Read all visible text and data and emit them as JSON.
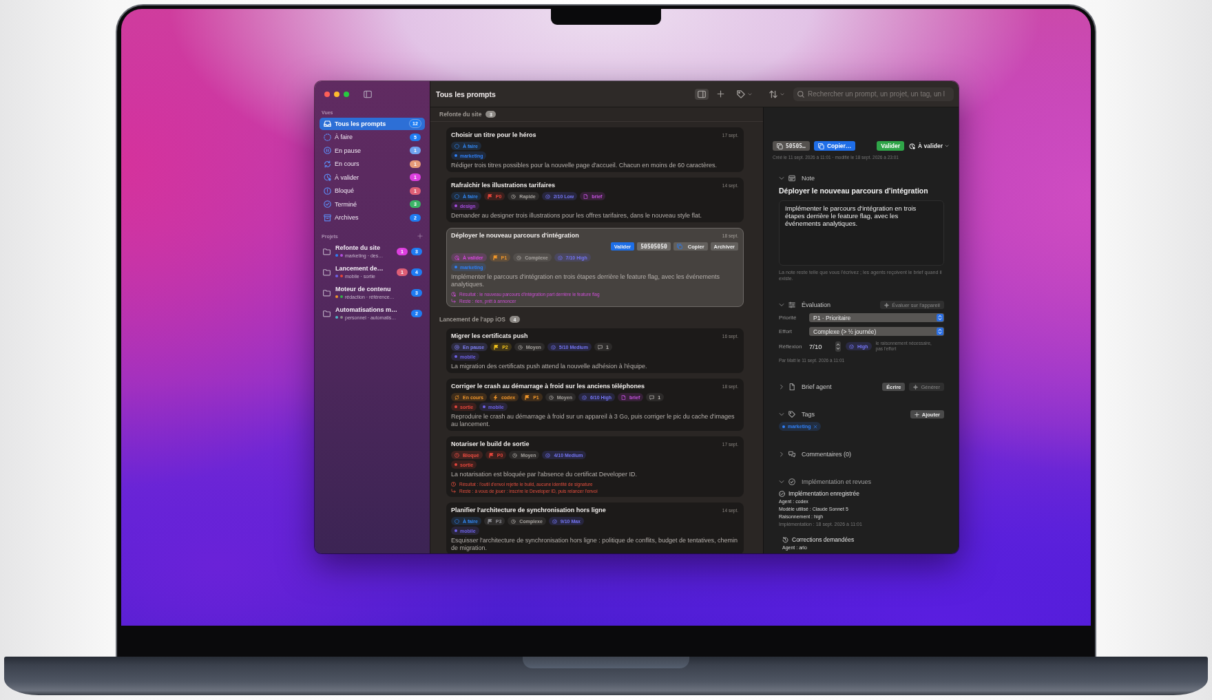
{
  "window": {
    "title": "Tous les prompts"
  },
  "toolbar": {
    "inspector_on": true,
    "search": {
      "placeholder": "Rechercher un prompt, un projet, un tag, un l"
    }
  },
  "sidebar": {
    "views_label": "Vues",
    "views": [
      {
        "kind": "all",
        "label": "Tous les prompts",
        "count": "12",
        "color": "#1f7cf2",
        "selected": true
      },
      {
        "kind": "todo",
        "label": "À faire",
        "count": "5",
        "color": "#1f7cf2",
        "selected": false
      },
      {
        "kind": "paused",
        "label": "En pause",
        "count": "1",
        "color": "#6fa3ef",
        "selected": false
      },
      {
        "kind": "in_progress",
        "label": "En cours",
        "count": "1",
        "color": "#e59a78",
        "selected": false
      },
      {
        "kind": "review",
        "label": "À valider",
        "count": "1",
        "color": "#dd3fdf",
        "selected": false
      },
      {
        "kind": "blocked",
        "label": "Bloqué",
        "count": "1",
        "color": "#de5f76",
        "selected": false
      },
      {
        "kind": "done",
        "label": "Terminé",
        "count": "3",
        "color": "#3bb466",
        "selected": false
      },
      {
        "kind": "archive",
        "label": "Archives",
        "count": "2",
        "color": "#1f7cf2",
        "selected": false
      }
    ],
    "projects_label": "Projets",
    "projects": [
      {
        "name": "Refonte du site",
        "summary": "marketing · des…",
        "tag_dots": [
          {
            "color": "#2f7ff5"
          },
          {
            "color": "#b34fe0"
          }
        ],
        "badges": [
          {
            "count": "1",
            "color": "#dd3fdf"
          },
          {
            "count": "3",
            "color": "#1f7cf2"
          }
        ],
        "selected": false
      },
      {
        "name": "Lancement de…",
        "summary": "mobile · sortie",
        "tag_dots": [
          {
            "color": "#6d62e8"
          },
          {
            "color": "#e5453b"
          }
        ],
        "badges": [
          {
            "count": "1",
            "color": "#de5f76"
          },
          {
            "count": "4",
            "color": "#1f7cf2"
          }
        ],
        "selected": false
      },
      {
        "name": "Moteur de contenu",
        "summary": "rédaction · référence…",
        "tag_dots": [
          {
            "color": "#f0962a"
          },
          {
            "color": "#35b24a"
          }
        ],
        "badges": [
          {
            "count": "3",
            "color": "#1f7cf2"
          }
        ],
        "selected": false
      },
      {
        "name": "Automatisations m…",
        "summary": "personnel · automatis…",
        "tag_dots": [
          {
            "color": "#4fb8c8"
          },
          {
            "color": "#8a8a8a"
          }
        ],
        "badges": [
          {
            "count": "2",
            "color": "#1f7cf2"
          }
        ],
        "selected": false
      }
    ]
  },
  "list": {
    "groups": [
      {
        "title": "Refonte du site",
        "count": "3",
        "cards": [
          {
            "title": "Choisir un titre pour le héros",
            "date": "17 sept.",
            "selected": false,
            "status": {
              "kind": "todo",
              "label": "À faire"
            },
            "tags": [
              {
                "label": "marketing",
                "color": "#2f7ff5"
              }
            ],
            "description": "Rédiger trois titres possibles pour la nouvelle page d'accueil. Chacun en moins de 60 caractères."
          },
          {
            "title": "Rafraîchir les illustrations tarifaires",
            "date": "14 sept.",
            "selected": false,
            "status": {
              "kind": "todo",
              "label": "À faire"
            },
            "chips": [
              {
                "kind": "priority",
                "label": "P0",
                "color": "#e5453b"
              },
              {
                "kind": "effort",
                "label": "Rapide"
              },
              {
                "kind": "reasoning",
                "label": "2/10 Low"
              },
              {
                "kind": "brief",
                "label": "brief"
              }
            ],
            "tags": [
              {
                "label": "design",
                "color": "#a64de0"
              }
            ],
            "description": "Demander au designer trois illustrations pour les offres tarifaires, dans le nouveau style flat."
          },
          {
            "title": "Déployer le nouveau parcours d'intégration",
            "date": "18 sept.",
            "selected": true,
            "actions": [
              {
                "kind": "validate",
                "label": "Valider"
              },
              {
                "kind": "id",
                "label": "50505050"
              },
              {
                "kind": "copy",
                "label": "Copier"
              },
              {
                "kind": "archive",
                "label": "Archiver"
              }
            ],
            "status": {
              "kind": "review",
              "label": "À valider"
            },
            "chips": [
              {
                "kind": "priority",
                "label": "P1",
                "color": "#f0962a"
              },
              {
                "kind": "effort",
                "label": "Complexe"
              },
              {
                "kind": "reasoning",
                "label": "7/10 High"
              }
            ],
            "tags": [
              {
                "label": "marketing",
                "color": "#2f7ff5"
              }
            ],
            "description": "Implémenter le parcours d'intégration en trois étapes derrière le feature flag, avec les événements analytiques.",
            "outcome": [
              {
                "kind": "result",
                "text": "Résultat : le nouveau parcours d'intégration part derrière le feature flag"
              },
              {
                "kind": "remaining",
                "text": "Reste : rien, prêt à annoncer"
              }
            ]
          }
        ]
      },
      {
        "title": "Lancement de l'app iOS",
        "count": "4",
        "cards": [
          {
            "title": "Migrer les certificats push",
            "date": "16 sept.",
            "selected": false,
            "status": {
              "kind": "paused",
              "label": "En pause"
            },
            "chips": [
              {
                "kind": "priority",
                "label": "P2",
                "color": "#f2c21c"
              },
              {
                "kind": "effort",
                "label": "Moyen"
              },
              {
                "kind": "reasoning",
                "label": "5/10 Medium"
              },
              {
                "kind": "comments",
                "label": "1"
              }
            ],
            "tags": [
              {
                "label": "mobile",
                "color": "#6d62e8"
              }
            ],
            "description": "La migration des certificats push attend la nouvelle adhésion à l'équipe."
          },
          {
            "title": "Corriger le crash au démarrage à froid sur les anciens téléphones",
            "date": "18 sept.",
            "selected": false,
            "status": {
              "kind": "in_progress",
              "label": "En cours"
            },
            "chips": [
              {
                "kind": "agent",
                "label": "codex"
              },
              {
                "kind": "priority",
                "label": "P1",
                "color": "#f0962a"
              },
              {
                "kind": "effort",
                "label": "Moyen"
              },
              {
                "kind": "reasoning",
                "label": "6/10 High"
              },
              {
                "kind": "brief",
                "label": "brief"
              },
              {
                "kind": "comments",
                "label": "1"
              }
            ],
            "tags": [
              {
                "label": "sortie",
                "color": "#e5453b"
              },
              {
                "label": "mobile",
                "color": "#6d62e8"
              }
            ],
            "description": "Reproduire le crash au démarrage à froid sur un appareil à 3 Go, puis corriger le pic du cache d'images au lancement."
          },
          {
            "title": "Notariser le build de sortie",
            "date": "17 sept.",
            "selected": false,
            "status": {
              "kind": "blocked",
              "label": "Bloqué"
            },
            "chips": [
              {
                "kind": "priority",
                "label": "P0",
                "color": "#e5453b"
              },
              {
                "kind": "effort",
                "label": "Moyen"
              },
              {
                "kind": "reasoning",
                "label": "4/10 Medium"
              }
            ],
            "tags": [
              {
                "label": "sortie",
                "color": "#e5453b"
              }
            ],
            "description": "La notarisation est bloquée par l'absence du certificat Developer ID.",
            "outcome": [
              {
                "kind": "result",
                "text": "Résultat : l'outil d'envoi rejette le build, aucune identité de signature"
              },
              {
                "kind": "remaining",
                "text": "Reste : à vous de jouer : inscrire le Developer ID, puis relancer l'envoi"
              }
            ]
          },
          {
            "title": "Planifier l'architecture de synchronisation hors ligne",
            "date": "14 sept.",
            "selected": false,
            "status": {
              "kind": "todo",
              "label": "À faire"
            },
            "chips": [
              {
                "kind": "priority",
                "label": "P3",
                "color": "#8e8e93"
              },
              {
                "kind": "effort",
                "label": "Complexe"
              },
              {
                "kind": "reasoning",
                "label": "9/10 Max"
              }
            ],
            "tags": [
              {
                "label": "mobile",
                "color": "#6d62e8"
              }
            ],
            "description": "Esquisser l'architecture de synchronisation hors ligne : politique de conflits, budget de tentatives, chemin de migration."
          }
        ]
      }
    ]
  },
  "detail": {
    "header": {
      "id": "50505…",
      "copy": "Copier…",
      "validate": "Valider",
      "status": {
        "kind": "review",
        "label": "À valider"
      }
    },
    "meta": "Créé le 11 sept. 2026 à 11:01 · modifié le 18 sept. 2026 à 23:01",
    "sections": [
      {
        "kind": "note",
        "title": "Note",
        "expanded": true,
        "heading": "Déployer le nouveau parcours d'intégration",
        "body": "Implémenter le parcours d'intégration en trois étapes derrière le feature flag, avec les événements analytiques.",
        "hint": "La note reste telle que vous l'écrivez ; les agents reçoivent le brief quand il existe."
      },
      {
        "kind": "evaluation",
        "title": "Évaluation",
        "expanded": true,
        "actions": [
          {
            "kind": "evaluate",
            "label": "Évaluer sur l'appareil",
            "disabled": true
          }
        ],
        "fields": [
          {
            "kind": "select",
            "label": "Priorité",
            "value": "P1 · Prioritaire"
          },
          {
            "kind": "select",
            "label": "Effort",
            "value": "Complexe (> ½ journée)"
          },
          {
            "kind": "stepper",
            "label": "Réflexion",
            "value": "7/10",
            "chip": "High",
            "note": "le raisonnement nécessaire, pas l'effort"
          }
        ],
        "byline": "Par Matt le 11 sept. 2026 à 11:01"
      },
      {
        "kind": "brief",
        "title": "Brief agent",
        "expanded": false,
        "actions": [
          {
            "kind": "write",
            "label": "Écrire",
            "disabled": false
          },
          {
            "kind": "generate",
            "label": "Générer",
            "disabled": true
          }
        ]
      },
      {
        "kind": "tags",
        "title": "Tags",
        "expanded": true,
        "actions": [
          {
            "kind": "add",
            "label": "Ajouter",
            "disabled": false
          }
        ],
        "tags": [
          {
            "label": "marketing",
            "color": "#2f7ff5"
          }
        ]
      },
      {
        "kind": "comments",
        "title": "Commentaires (0)",
        "expanded": false
      },
      {
        "kind": "reviews",
        "title": "Implémentation et revues",
        "expanded": true,
        "entries": [
          {
            "kind": "implementation",
            "title": "Implémentation enregistrée",
            "lines": [
              "Agent : codex",
              "Modèle utilisé : Claude Sonnet 5",
              "Raisonnement : high"
            ],
            "footnote": "Implémentation : 18 sept. 2026 à 11:01"
          },
          {
            "kind": "corrections",
            "title": "Corrections demandées",
            "lines": [
              "Agent : arlo"
            ]
          }
        ]
      }
    ]
  }
}
